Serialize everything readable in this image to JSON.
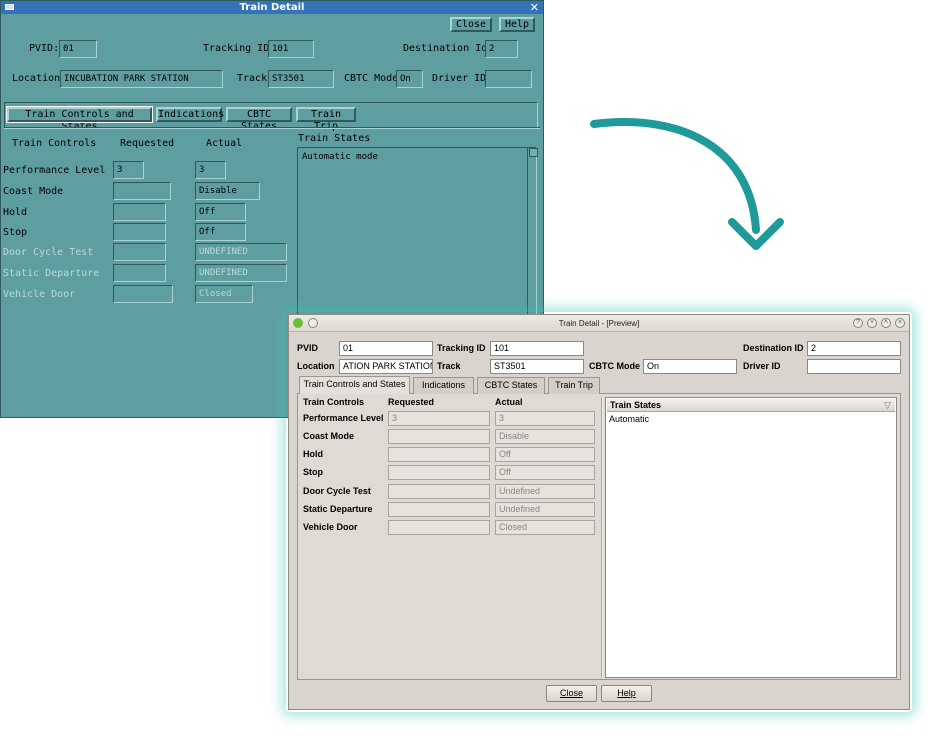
{
  "old": {
    "title": "Train Detail",
    "close_label": "Close",
    "help_label": "Help",
    "pvid_label": "PVID:",
    "pvid_value": "01",
    "tracking_label": "Tracking ID",
    "tracking_value": "101",
    "dest_label": "Destination Id",
    "dest_value": "2",
    "location_label": "Location",
    "location_value": "INCUBATION PARK STATION",
    "track_label": "Track",
    "track_value": "ST3501",
    "cbtc_label": "CBTC Mode",
    "cbtc_value": "On",
    "driver_label": "Driver ID",
    "driver_value": "",
    "tabs": [
      "Train Controls and States",
      "Indications",
      "CBTC States",
      "Train Trip"
    ],
    "col_controls": "Train Controls",
    "col_requested": "Requested",
    "col_actual": "Actual",
    "states_label": "Train States",
    "states_text": "Automatic mode",
    "rows": [
      {
        "label": "Performance Level",
        "requested": "3",
        "actual": "3"
      },
      {
        "label": "Coast Mode",
        "requested": "",
        "actual": "Disable"
      },
      {
        "label": "Hold",
        "requested": "",
        "actual": "Off"
      },
      {
        "label": "Stop",
        "requested": "",
        "actual": "Off"
      },
      {
        "label": "Door Cycle Test",
        "requested": "",
        "actual": "UNDEFINED"
      },
      {
        "label": "Static Departure",
        "requested": "",
        "actual": "UNDEFINED"
      },
      {
        "label": "Vehicle Door",
        "requested": "",
        "actual": "Closed"
      }
    ]
  },
  "new": {
    "title": "Train Detail - [Preview]",
    "pvid_label": "PVID",
    "pvid_value": "01",
    "tracking_label": "Tracking ID",
    "tracking_value": "101",
    "dest_label": "Destination ID",
    "dest_value": "2",
    "location_label": "Location",
    "location_value": "ATION PARK STATION",
    "track_label": "Track",
    "track_value": "ST3501",
    "cbtc_label": "CBTC Mode",
    "cbtc_value": "On",
    "driver_label": "Driver ID",
    "driver_value": "",
    "tabs": [
      "Train Controls and States",
      "Indications",
      "CBTC States",
      "Train Trip"
    ],
    "col_controls": "Train Controls",
    "col_requested": "Requested",
    "col_actual": "Actual",
    "states_label": "Train States",
    "states_item": "Automatic",
    "rows": [
      {
        "label": "Performance Level",
        "requested": "3",
        "actual": "3"
      },
      {
        "label": "Coast Mode",
        "requested": "",
        "actual": "Disable"
      },
      {
        "label": "Hold",
        "requested": "",
        "actual": "Off"
      },
      {
        "label": "Stop",
        "requested": "",
        "actual": "Off"
      },
      {
        "label": "Door Cycle Test",
        "requested": "",
        "actual": "Undefined"
      },
      {
        "label": "Static Departure",
        "requested": "",
        "actual": "Undefined"
      },
      {
        "label": "Vehicle Door",
        "requested": "",
        "actual": "Closed"
      }
    ],
    "close_label": "Close",
    "help_label": "Help"
  },
  "colors": {
    "motif_bg": "#5f9ea0",
    "motif_title": "#3573b8",
    "qt_bg": "#d9d5ce",
    "arrow": "#1f9a9a",
    "glow": "#38c8b4"
  },
  "icons": [
    "window-menu-icon",
    "close-x-icon",
    "app-logo-icon",
    "help-icon",
    "minimize-icon",
    "maximize-icon",
    "close-icon",
    "filter-funnel-icon",
    "scroll-up-arrow-icon",
    "transition-arrow-icon"
  ]
}
